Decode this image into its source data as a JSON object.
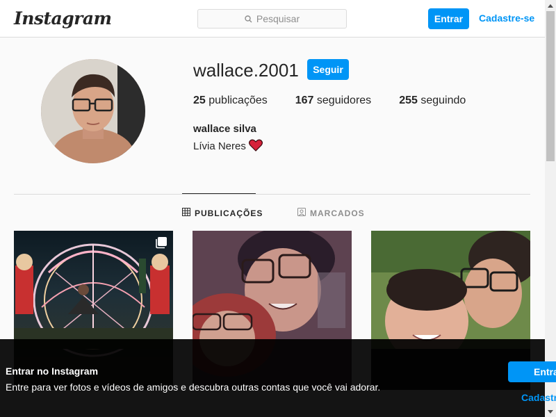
{
  "header": {
    "logo": "Instagram",
    "search_placeholder": "Pesquisar",
    "login_label": "Entrar",
    "signup_label": "Cadastre-se"
  },
  "profile": {
    "username": "wallace.2001",
    "follow_label": "Seguir",
    "posts_count": "25",
    "posts_label": "publicações",
    "followers_count": "167",
    "followers_label": "seguidores",
    "following_count": "255",
    "following_label": "seguindo",
    "full_name": "wallace silva",
    "bio": "Lívia Neres",
    "bio_emoji": "❤️"
  },
  "tabs": [
    {
      "label": "PUBLICAÇÕES",
      "icon": "grid-icon",
      "active": true
    },
    {
      "label": "MARCADOS",
      "icon": "tag-icon",
      "active": false
    }
  ],
  "posts": [
    {
      "icon": "multiple-photos-icon"
    },
    {},
    {}
  ],
  "banner": {
    "title": "Entrar no Instagram",
    "text": "Entre para ver fotos e vídeos de amigos e descubra outras contas que você vai adorar.",
    "login_label": "Entrar",
    "signup_label": "Cadastre-se"
  },
  "colors": {
    "accent": "#0095f6",
    "text": "#262626",
    "muted": "#8e8e8e",
    "border": "#dbdbdb"
  }
}
